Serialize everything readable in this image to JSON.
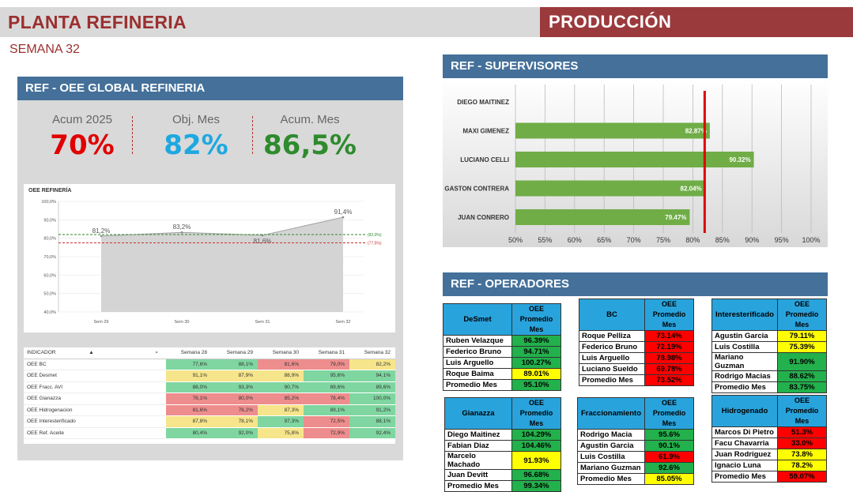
{
  "header": {
    "title": "PLANTA REFINERIA",
    "section": "PRODUCCIÓN",
    "week": "SEMANA 32"
  },
  "oee_panel": {
    "title": "REF - OEE GLOBAL REFINERIA",
    "kpis": [
      {
        "label": "Acum 2025",
        "value": "70%",
        "color": "#e00000"
      },
      {
        "label": "Obj. Mes",
        "value": "82%",
        "color": "#1ea8e0"
      },
      {
        "label": "Acum. Mes",
        "value": "86,5%",
        "color": "#2e8b2e"
      }
    ]
  },
  "chart_data": [
    {
      "type": "area",
      "title": "OEE REFINERÍA",
      "categories": [
        "Sem 29",
        "Sem 30",
        "Sem 31",
        "Sem 32"
      ],
      "values": [
        81.2,
        83.2,
        81.6,
        91.4
      ],
      "value_labels": [
        "81,2%",
        "83,2%",
        "81,6%",
        "91,4%"
      ],
      "yticks": [
        "40,0%",
        "50,0%",
        "60,0%",
        "70,0%",
        "80,0%",
        "90,0%",
        "100,0%"
      ],
      "ylim": [
        40,
        100
      ],
      "reference_lines": [
        {
          "value": 82.0,
          "label": "(82,0%)",
          "color": "#2e8b2e"
        },
        {
          "value": 77.5,
          "label": "(77,5%)",
          "color": "#cc3333"
        }
      ]
    },
    {
      "type": "bar",
      "title": "REF - SUPERVISORES",
      "categories": [
        "DIEGO MAITINEZ",
        "MAXI GIMENEZ",
        "LUCIANO CELLI",
        "GASTON CONTRERA",
        "JUAN CONRERO"
      ],
      "values": [
        null,
        82.87,
        90.32,
        82.04,
        79.47
      ],
      "value_labels": [
        "",
        "82.87%",
        "90.32%",
        "82.04%",
        "79.47%"
      ],
      "xticks": [
        "50%",
        "55%",
        "60%",
        "65%",
        "70%",
        "75%",
        "80%",
        "85%",
        "90%",
        "95%",
        "100%"
      ],
      "xlim": [
        50,
        100
      ],
      "target": 82,
      "grid": true
    }
  ],
  "indicator_table": {
    "headers": [
      "INDICADOR",
      "Semana 28",
      "Semana 29",
      "Semana 30",
      "Semana 31",
      "Semana 32"
    ],
    "rows": [
      {
        "name": "OEE BC",
        "values": [
          "77,6%",
          "88,1%",
          "81,6%",
          "79,0%",
          "82,2%"
        ],
        "colors": [
          "g",
          "g",
          "r",
          "r",
          "y"
        ]
      },
      {
        "name": "OEE Desmet",
        "values": [
          "91,1%",
          "87,9%",
          "88,9%",
          "95,6%",
          "94,1%"
        ],
        "colors": [
          "y",
          "y",
          "y",
          "g",
          "g"
        ]
      },
      {
        "name": "OEE Fracc. AVI",
        "values": [
          "88,0%",
          "93,3%",
          "90,7%",
          "89,6%",
          "89,6%"
        ],
        "colors": [
          "g",
          "g",
          "g",
          "g",
          "g"
        ]
      },
      {
        "name": "OEE Gianazza",
        "values": [
          "76,1%",
          "80,0%",
          "85,2%",
          "78,4%",
          "100,0%"
        ],
        "colors": [
          "r",
          "r",
          "r",
          "r",
          "g"
        ]
      },
      {
        "name": "OEE Hidrogenacion",
        "values": [
          "81,6%",
          "76,2%",
          "87,3%",
          "89,1%",
          "91,2%"
        ],
        "colors": [
          "r",
          "r",
          "y",
          "g",
          "g"
        ]
      },
      {
        "name": "OEE Interesterificado",
        "values": [
          "87,8%",
          "78,1%",
          "97,3%",
          "72,5%",
          "88,1%"
        ],
        "colors": [
          "y",
          "y",
          "g",
          "r",
          "g"
        ]
      },
      {
        "name": "OEE Ref. Aceite",
        "values": [
          "80,4%",
          "92,0%",
          "75,8%",
          "72,9%",
          "92,4%"
        ],
        "colors": [
          "g",
          "g",
          "y",
          "r",
          "g"
        ]
      }
    ]
  },
  "operators": {
    "title": "REF - OPERADORES",
    "col_header": "OEE Promedio Mes",
    "groups": [
      {
        "name": "DeSmet",
        "rows": [
          [
            "Ruben Velazque",
            "96.39%",
            "g"
          ],
          [
            "Federico Bruno",
            "94.71%",
            "g"
          ],
          [
            "Luis Arguello",
            "100.27%",
            "g"
          ],
          [
            "Roque Baima",
            "89.01%",
            "y"
          ],
          [
            "Promedio Mes",
            "95.10%",
            "g"
          ]
        ]
      },
      {
        "name": "BC",
        "rows": [
          [
            "Roque Pelliza",
            "73.14%",
            "r"
          ],
          [
            "Federico Bruno",
            "72.19%",
            "r"
          ],
          [
            "Luis Arguello",
            "78.98%",
            "r"
          ],
          [
            "Luciano Sueldo",
            "69.78%",
            "r"
          ],
          [
            "Promedio Mes",
            "73.52%",
            "r"
          ]
        ]
      },
      {
        "name": "Interesterificado",
        "rows": [
          [
            "Agustin Garcia",
            "79.11%",
            "y"
          ],
          [
            "Luis Costilla",
            "75.39%",
            "y"
          ],
          [
            "Mariano Guzman",
            "91.90%",
            "g"
          ],
          [
            "Rodrigo Macias",
            "88.62%",
            "g"
          ],
          [
            "Promedio Mes",
            "83.75%",
            "g"
          ]
        ]
      },
      {
        "name": "Gianazza",
        "rows": [
          [
            "Diego Maitinez",
            "104.29%",
            "g"
          ],
          [
            "Fabian Diaz",
            "104.46%",
            "g"
          ],
          [
            "Marcelo Machado",
            "91.93%",
            "y"
          ],
          [
            "Juan Devitt",
            "96.68%",
            "g"
          ],
          [
            "Promedio Mes",
            "99.34%",
            "g"
          ]
        ]
      },
      {
        "name": "Fraccionamiento",
        "rows": [
          [
            "Rodrigo Macia",
            "95.6%",
            "g"
          ],
          [
            "Agustin Garcia",
            "90.1%",
            "g"
          ],
          [
            "Luis Costilla",
            "61.9%",
            "r"
          ],
          [
            "Mariano Guzman",
            "92.6%",
            "g"
          ],
          [
            "Promedio Mes",
            "85.05%",
            "y"
          ]
        ]
      },
      {
        "name": "Hidrogenado",
        "rows": [
          [
            "Marcos Di Pietro",
            "51.3%",
            "r"
          ],
          [
            "Facu Chavarria",
            "33.0%",
            "r"
          ],
          [
            "Juan Rodriguez",
            "73.8%",
            "y"
          ],
          [
            "Ignacio Luna",
            "78.2%",
            "y"
          ],
          [
            "Promedio Mes",
            "59.07%",
            "r"
          ]
        ]
      }
    ]
  }
}
